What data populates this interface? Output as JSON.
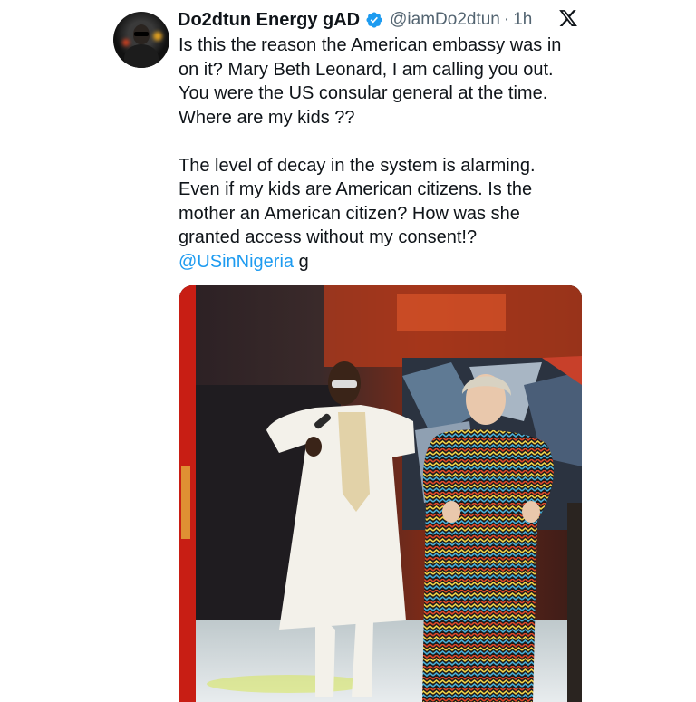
{
  "tweet": {
    "author_name": "Do2dtun Energy gAD",
    "handle": "@iamDo2dtun",
    "separator": "·",
    "time": "1h",
    "lines_para1": [
      "Is this the reason the American embassy was in",
      "on it? Mary Beth Leonard, I am calling you out.",
      "You were the US consular general at the time.",
      "Where are my kids ??"
    ],
    "lines_para2": [
      "The level of decay in the system is alarming.",
      "Even if my kids are American citizens. Is the",
      "mother an American citizen? How was she",
      "granted access without my consent!?"
    ],
    "mention": "@USinNigeria",
    "trailing_text": " g",
    "verified_color": "#1d9bf0",
    "link_color": "#1d9bf0"
  },
  "icons": {
    "verified": "verified-badge-icon",
    "platform": "x-logo-icon"
  }
}
